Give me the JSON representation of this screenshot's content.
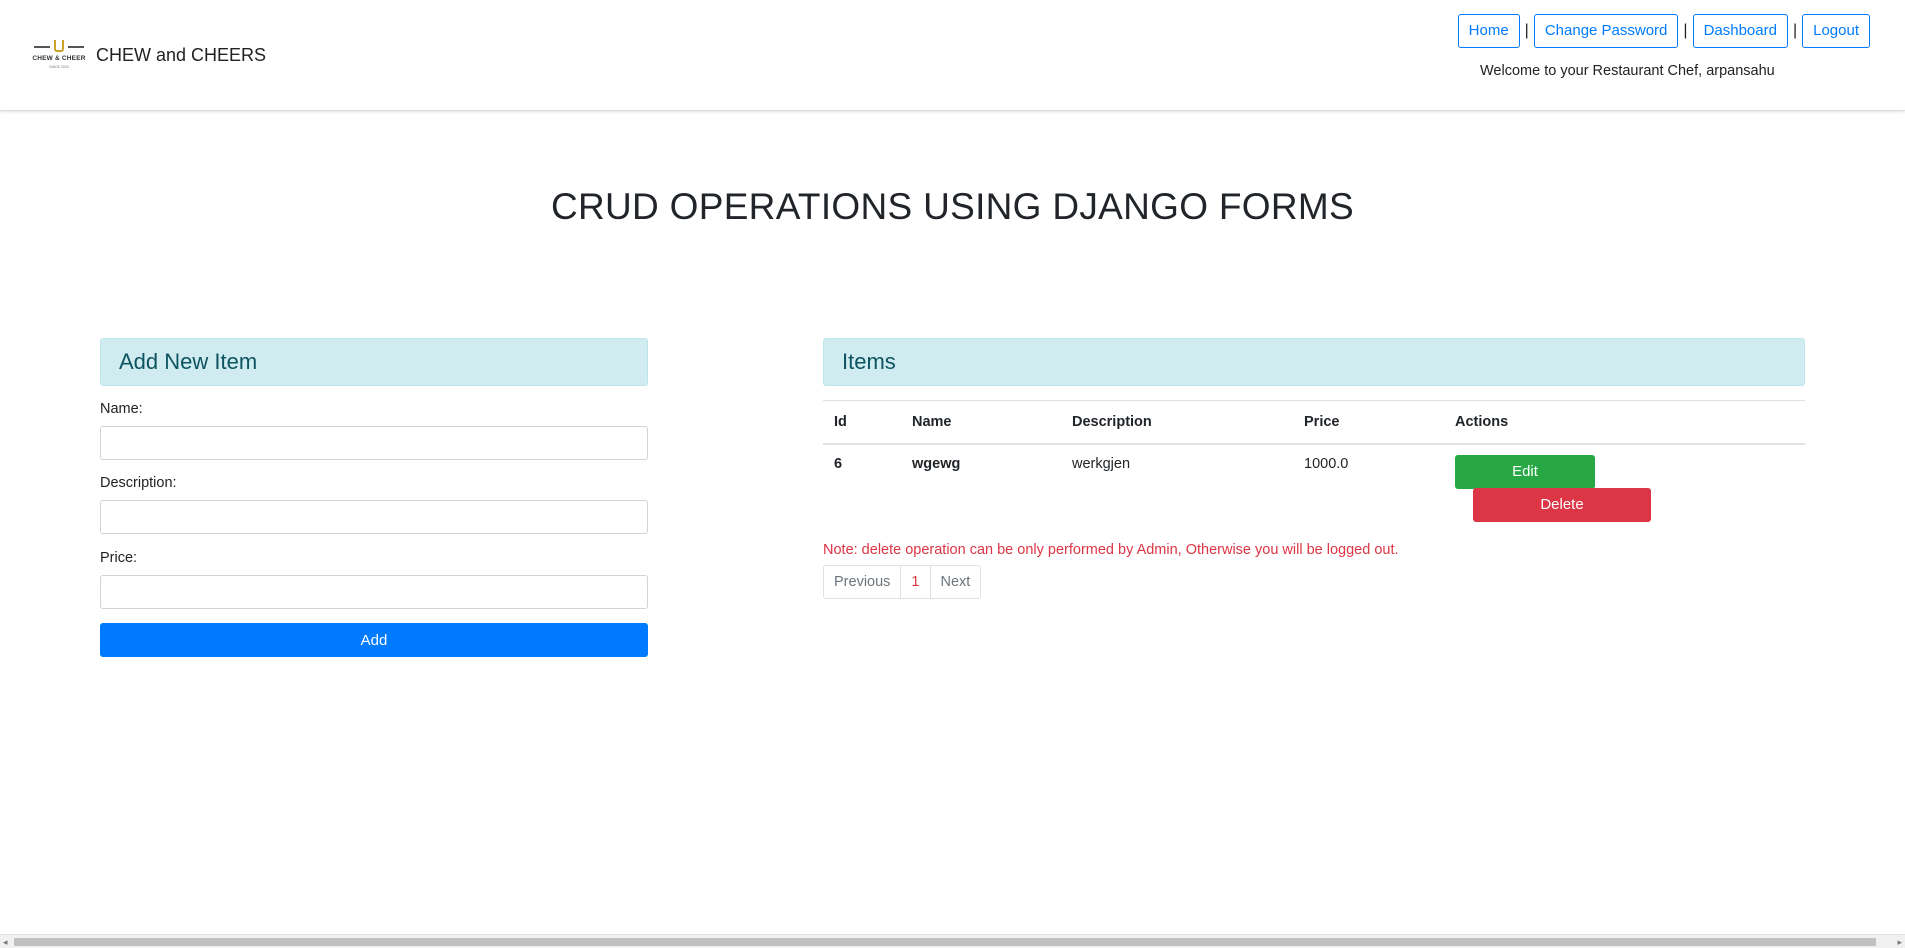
{
  "header": {
    "brand_name": "CHEW and CHEERS",
    "logo_text": "CHEW & CHEER",
    "logo_subtext": "SINCE 2023",
    "nav": {
      "home": "Home",
      "change_password": "Change Password",
      "dashboard": "Dashboard",
      "logout": "Logout",
      "separator": "|"
    },
    "welcome": "Welcome to your Restaurant Chef, arpansahu"
  },
  "page_title": "CRUD OPERATIONS USING DJANGO FORMS",
  "form": {
    "heading": "Add New Item",
    "name_label": "Name:",
    "name_value": "",
    "description_label": "Description:",
    "description_value": "",
    "price_label": "Price:",
    "price_value": "",
    "submit_label": "Add"
  },
  "items": {
    "heading": "Items",
    "columns": [
      "Id",
      "Name",
      "Description",
      "Price",
      "Actions"
    ],
    "rows": [
      {
        "id": "6",
        "name": "wgewg",
        "description": "werkgjen",
        "price": "1000.0",
        "edit_label": "Edit",
        "delete_label": "Delete"
      }
    ],
    "note": "Note: delete operation can be only performed by Admin, Otherwise you will be logged out.",
    "pagination": {
      "previous": "Previous",
      "current": "1",
      "next": "Next"
    }
  },
  "colors": {
    "primary": "#007bff",
    "success": "#28a745",
    "danger": "#dc3545",
    "panel_header_bg": "#d1ecf1",
    "panel_header_text": "#0c5460"
  },
  "icons": {
    "scroll_left": "triangle-left",
    "scroll_right": "triangle-right"
  }
}
